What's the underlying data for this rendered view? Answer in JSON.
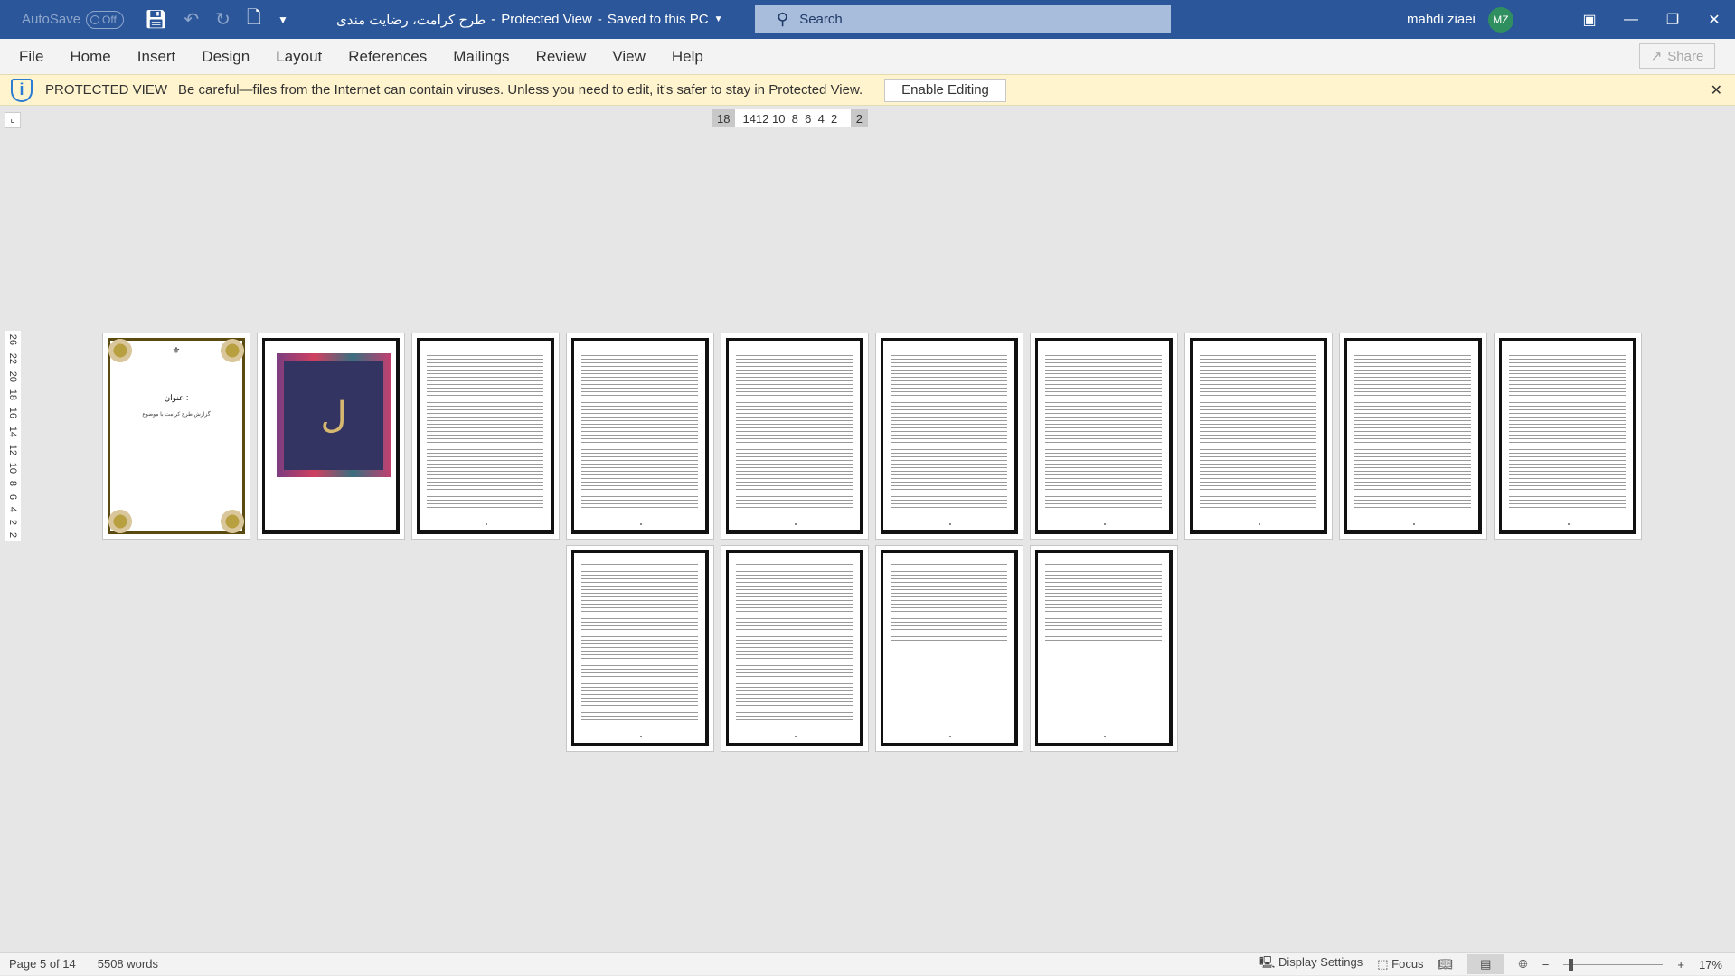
{
  "titlebar": {
    "autosave_label": "AutoSave",
    "autosave_state": "Off",
    "doc_title": "طرح کرامت، رضایت مندی",
    "mode": "Protected View",
    "save_status": "Saved to this PC",
    "search_placeholder": "Search",
    "user_name": "mahdi ziaei",
    "user_initials": "MZ"
  },
  "menu": [
    "File",
    "Home",
    "Insert",
    "Design",
    "Layout",
    "References",
    "Mailings",
    "Review",
    "View",
    "Help"
  ],
  "share_label": "Share",
  "protected_view": {
    "label": "PROTECTED VIEW",
    "message": "Be careful—files from the Internet can contain viruses. Unless you need to edit, it's safer to stay in Protected View.",
    "button": "Enable Editing"
  },
  "ruler": {
    "left": "18",
    "ticks": "1412 10  8  6  4  2",
    "right": "2"
  },
  "vruler": [
    "2",
    "2",
    "4",
    "6",
    "8",
    "10",
    "12",
    "14",
    "16",
    "18",
    "20",
    "22",
    "26"
  ],
  "cover": {
    "heading": "عنوان :",
    "subtitle": "گزارش طرح کرامت با موضوع"
  },
  "status": {
    "page": "Page 5 of 14",
    "words": "5508 words",
    "display_settings": "Display Settings",
    "focus": "Focus",
    "zoom": "17%",
    "zoom_value_percent": 17
  }
}
